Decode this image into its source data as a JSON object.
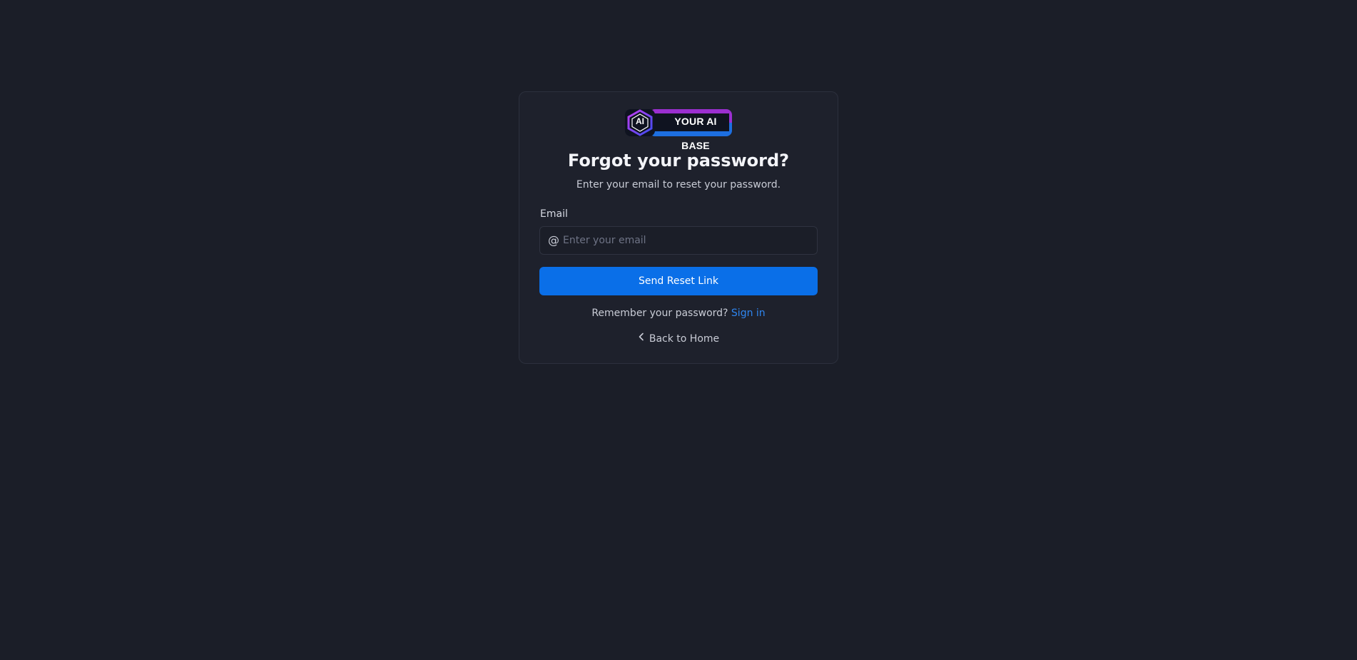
{
  "logo": {
    "badge_text": "AI",
    "brand_text": "YOUR AI BASE"
  },
  "page": {
    "title": "Forgot your password?",
    "subtitle": "Enter your email to reset your password."
  },
  "form": {
    "email_label": "Email",
    "email_value": "",
    "email_placeholder": "Enter your email",
    "email_icon": "at-icon",
    "submit_label": "Send Reset Link"
  },
  "footer": {
    "remember_text": "Remember your password?",
    "sign_in_label": "Sign in",
    "back_label": "Back to Home",
    "back_icon": "chevron-left-icon"
  },
  "colors": {
    "background": "#1b1e28",
    "card": "#1e212c",
    "primary": "#0a6fe8",
    "link": "#2f86f0",
    "logo_purple": "#9b2fd0",
    "logo_blue": "#1d6fe0"
  }
}
